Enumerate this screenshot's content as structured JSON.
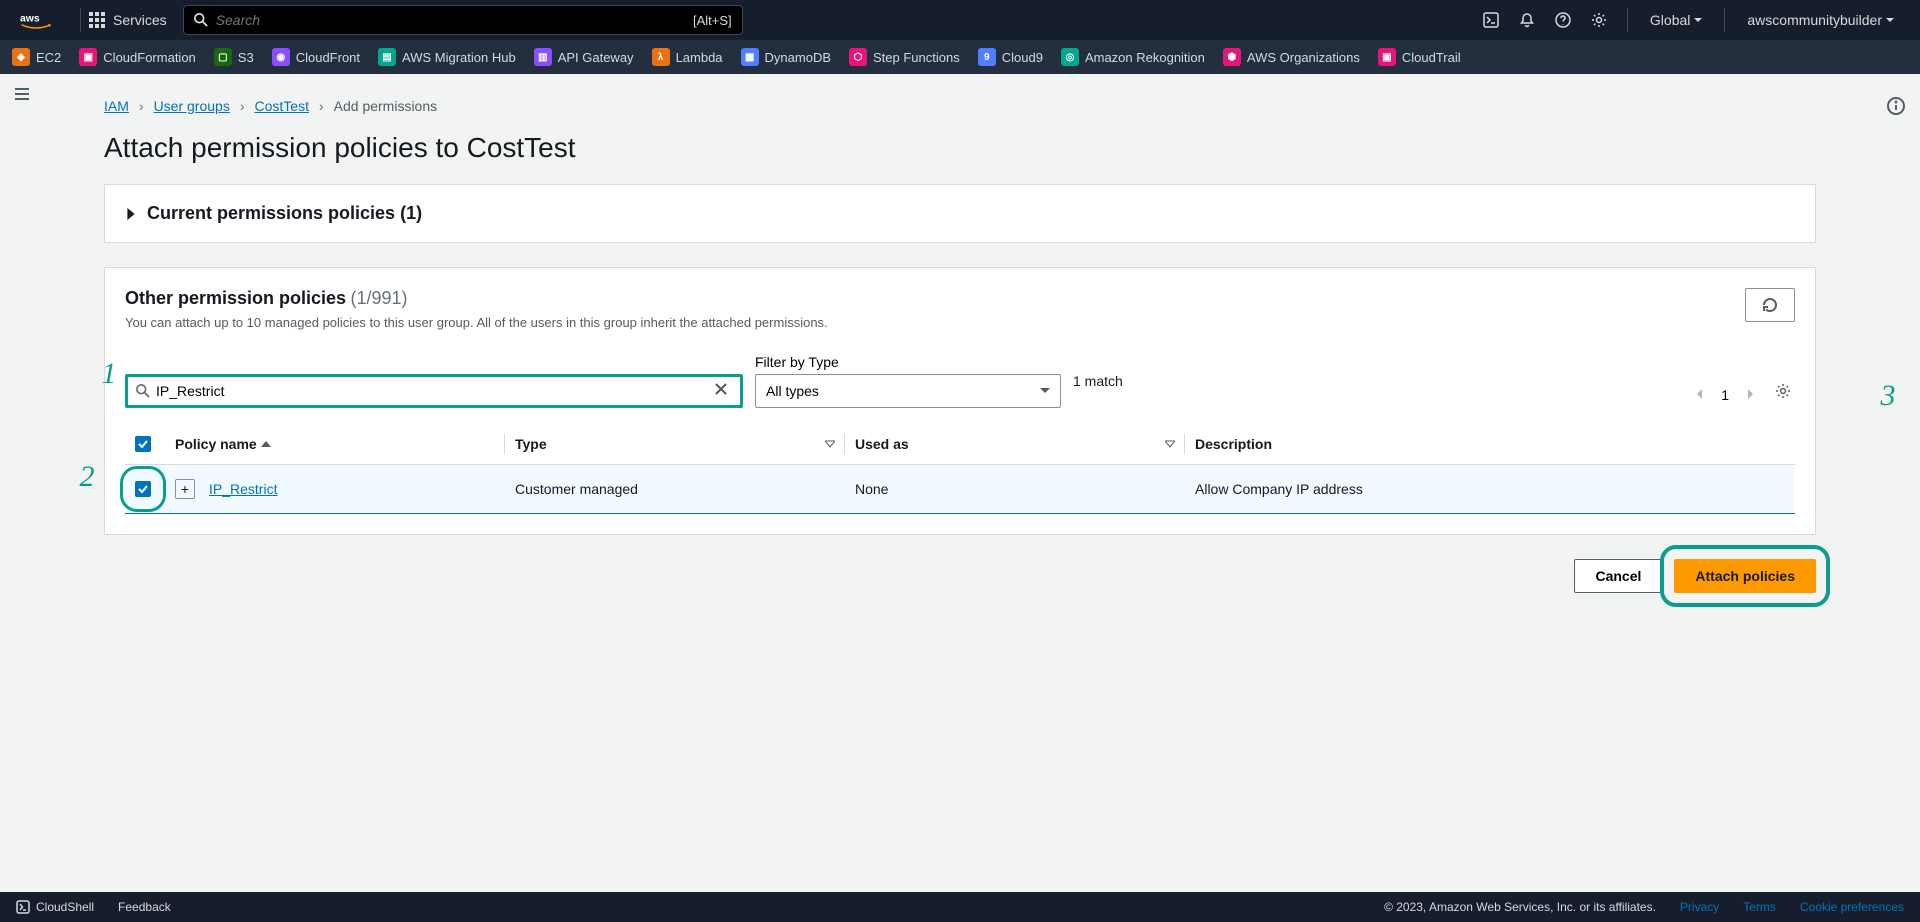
{
  "header": {
    "services": "Services",
    "search_placeholder": "Search",
    "search_kbd": "[Alt+S]",
    "region": "Global",
    "account": "awscommunitybuilder"
  },
  "shortcuts": [
    "EC2",
    "CloudFormation",
    "S3",
    "CloudFront",
    "AWS Migration Hub",
    "API Gateway",
    "Lambda",
    "DynamoDB",
    "Step Functions",
    "Cloud9",
    "Amazon Rekognition",
    "AWS Organizations",
    "CloudTrail"
  ],
  "breadcrumb": {
    "items": [
      "IAM",
      "User groups",
      "CostTest"
    ],
    "current": "Add permissions"
  },
  "page_title": "Attach permission policies to CostTest",
  "current_panel": {
    "title": "Current permissions policies (1)"
  },
  "other_panel": {
    "title": "Other permission policies",
    "count": "(1/991)",
    "subtitle": "You can attach up to 10 managed policies to this user group. All of the users in this group inherit the attached permissions.",
    "search_value": "IP_Restrict",
    "filter_label": "Filter by Type",
    "filter_value": "All types",
    "match_info": "1 match",
    "page": "1"
  },
  "table": {
    "columns": [
      "Policy name",
      "Type",
      "Used as",
      "Description"
    ],
    "rows": [
      {
        "name": "IP_Restrict",
        "type": "Customer managed",
        "used_as": "None",
        "description": "Allow Company IP address",
        "checked": true
      }
    ]
  },
  "actions": {
    "cancel": "Cancel",
    "attach": "Attach policies"
  },
  "callouts": {
    "c1": "1",
    "c2": "2",
    "c3": "3"
  },
  "footer": {
    "cloudshell": "CloudShell",
    "feedback": "Feedback",
    "copyright": "© 2023, Amazon Web Services, Inc. or its affiliates.",
    "links": [
      "Privacy",
      "Terms",
      "Cookie preferences"
    ]
  }
}
